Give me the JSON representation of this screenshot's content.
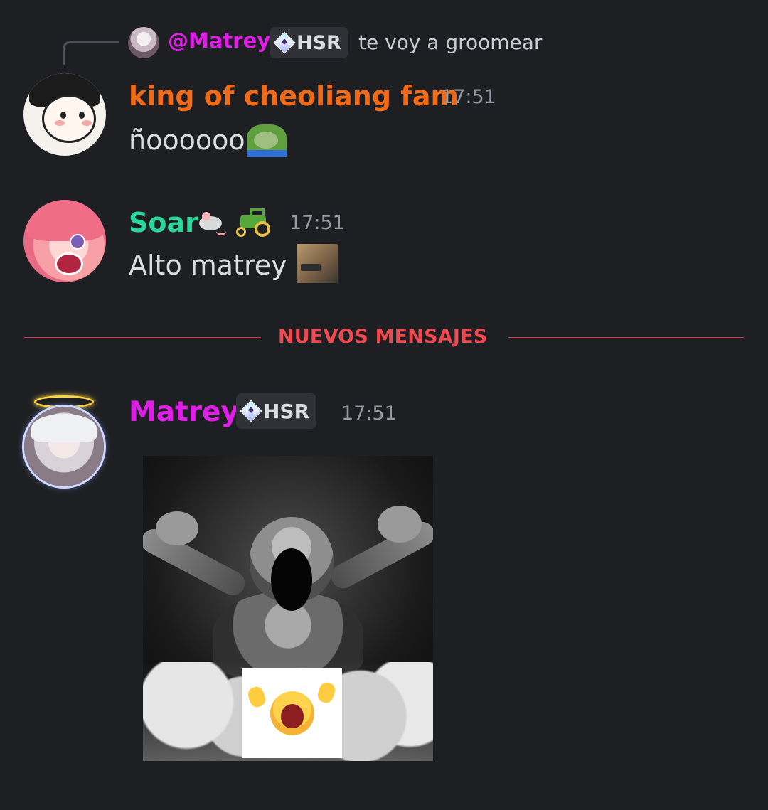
{
  "reply_preview": {
    "username": "@Matrey",
    "tag": "HSR",
    "text": "te voy a groomear"
  },
  "messages": [
    {
      "author": "king of cheoliang fam",
      "author_color": "#f06a17",
      "time": "17:51",
      "text": "ñoooooo",
      "emoji": "frog-emoji"
    },
    {
      "author": "Soar",
      "author_color": "#2bd69b",
      "time": "17:51",
      "text": "Alto matrey",
      "name_emojis": [
        "rat-icon",
        "tractor-icon"
      ],
      "emoji": "gun-pointing-emoji"
    },
    {
      "author": "Matrey",
      "author_color": "#e01ee8",
      "tag": "HSR",
      "time": "17:51",
      "attachment": "screaming-statue-image"
    }
  ],
  "divider": {
    "label": "NUEVOS MENSAJES",
    "color": "#f0484f"
  }
}
